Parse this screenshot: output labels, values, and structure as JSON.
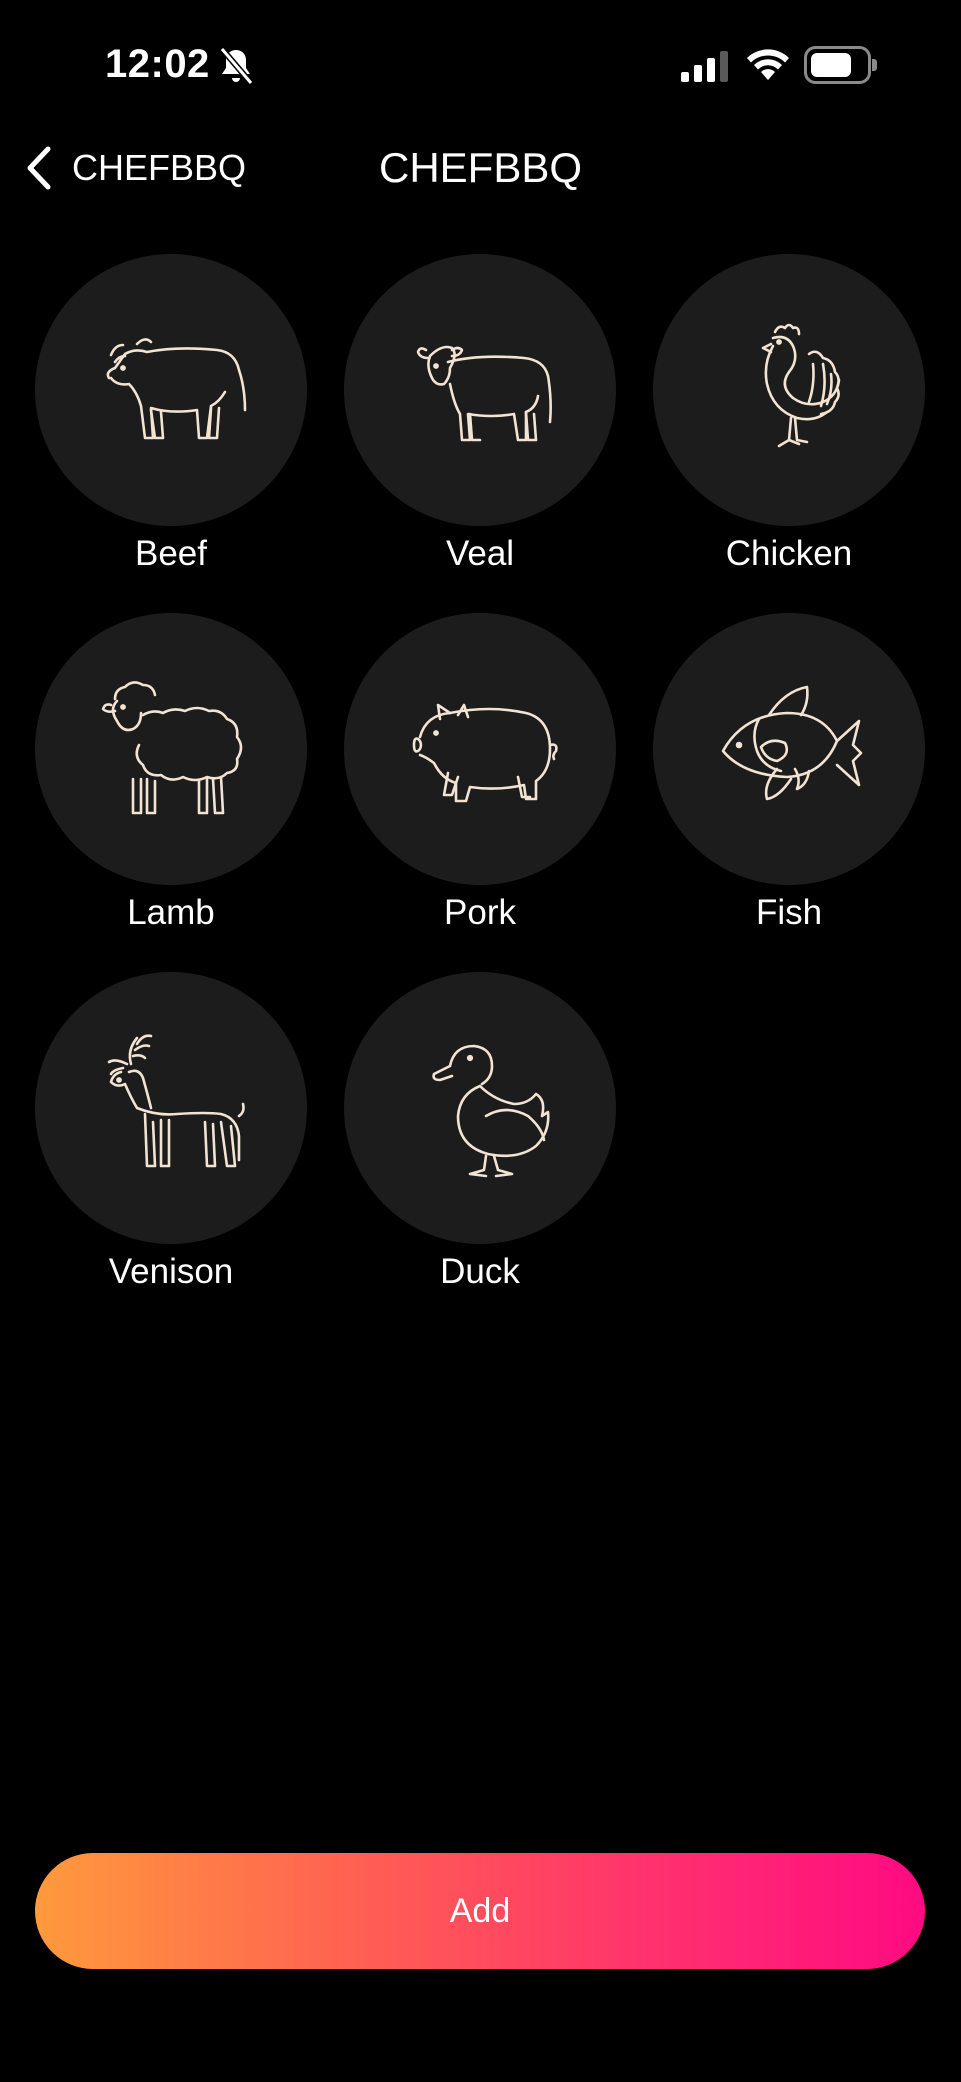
{
  "status_bar": {
    "time": "12:02",
    "icons": [
      "bell-slash-icon",
      "cellular-signal-icon",
      "wifi-icon",
      "battery-icon"
    ]
  },
  "nav": {
    "back_label": "CHEFBBQ",
    "title": "CHEFBBQ"
  },
  "meats": [
    {
      "label": "Beef",
      "icon": "cow-icon"
    },
    {
      "label": "Veal",
      "icon": "calf-icon"
    },
    {
      "label": "Chicken",
      "icon": "chicken-icon"
    },
    {
      "label": "Lamb",
      "icon": "sheep-icon"
    },
    {
      "label": "Pork",
      "icon": "pig-icon"
    },
    {
      "label": "Fish",
      "icon": "fish-icon"
    },
    {
      "label": "Venison",
      "icon": "deer-icon"
    },
    {
      "label": "Duck",
      "icon": "duck-icon"
    }
  ],
  "actions": {
    "add_label": "Add"
  },
  "colors": {
    "background": "#000000",
    "tile": "#1c1c1c",
    "icon_stroke": "#f3e3d3",
    "gradient_start": "#ff9a3c",
    "gradient_end": "#ff0a82"
  }
}
